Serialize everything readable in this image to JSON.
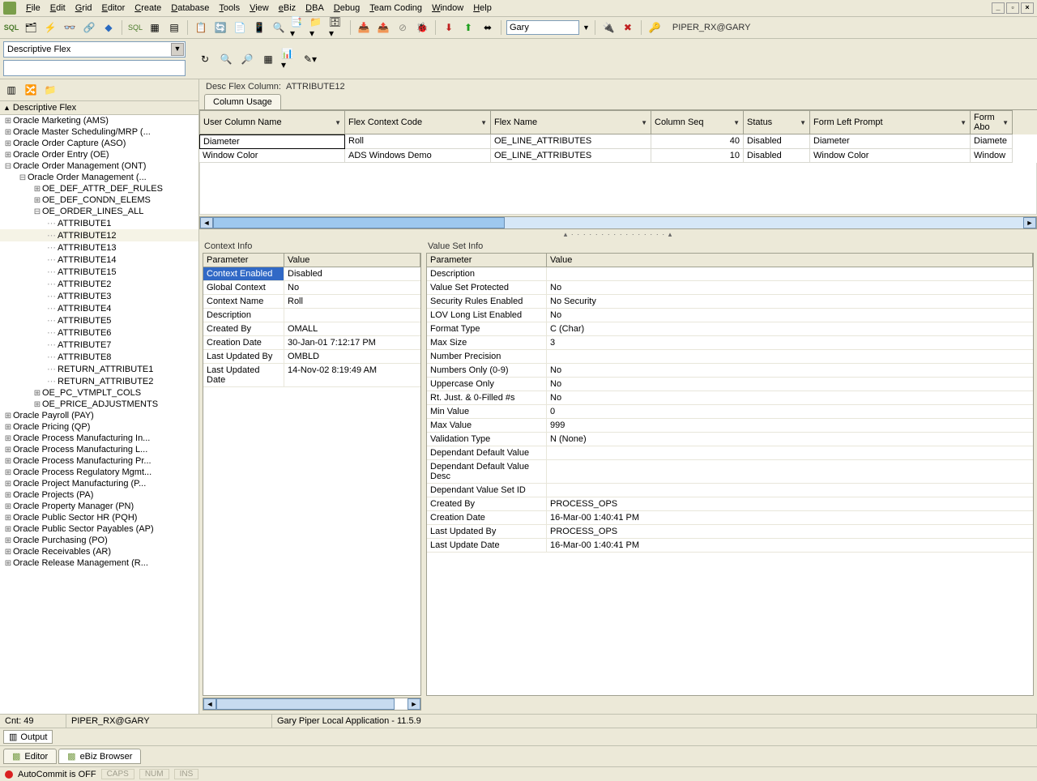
{
  "menubar": [
    "File",
    "Edit",
    "Grid",
    "Editor",
    "Create",
    "Database",
    "Tools",
    "View",
    "eBiz",
    "DBA",
    "Debug",
    "Team Coding",
    "Window",
    "Help"
  ],
  "toolbar": {
    "user": "Gary",
    "db_label": "PIPER_RX@GARY"
  },
  "flex_combo": "Descriptive Flex",
  "tree_header": "Descriptive Flex",
  "tree": [
    {
      "lvl": 0,
      "exp": "+",
      "label": "Oracle Marketing  (AMS)"
    },
    {
      "lvl": 0,
      "exp": "+",
      "label": "Oracle Master Scheduling/MRP  (..."
    },
    {
      "lvl": 0,
      "exp": "+",
      "label": "Oracle Order Capture  (ASO)"
    },
    {
      "lvl": 0,
      "exp": "+",
      "label": "Oracle Order Entry  (OE)"
    },
    {
      "lvl": 0,
      "exp": "-",
      "label": "Oracle Order Management  (ONT)"
    },
    {
      "lvl": 1,
      "exp": "-",
      "label": "Oracle Order Management  (..."
    },
    {
      "lvl": 2,
      "exp": "+",
      "label": "OE_DEF_ATTR_DEF_RULES"
    },
    {
      "lvl": 2,
      "exp": "+",
      "label": "OE_DEF_CONDN_ELEMS"
    },
    {
      "lvl": 2,
      "exp": "-",
      "label": "OE_ORDER_LINES_ALL"
    },
    {
      "lvl": 3,
      "leaf": true,
      "label": "ATTRIBUTE1"
    },
    {
      "lvl": 3,
      "leaf": true,
      "label": "ATTRIBUTE12",
      "selected": true
    },
    {
      "lvl": 3,
      "leaf": true,
      "label": "ATTRIBUTE13"
    },
    {
      "lvl": 3,
      "leaf": true,
      "label": "ATTRIBUTE14"
    },
    {
      "lvl": 3,
      "leaf": true,
      "label": "ATTRIBUTE15"
    },
    {
      "lvl": 3,
      "leaf": true,
      "label": "ATTRIBUTE2"
    },
    {
      "lvl": 3,
      "leaf": true,
      "label": "ATTRIBUTE3"
    },
    {
      "lvl": 3,
      "leaf": true,
      "label": "ATTRIBUTE4"
    },
    {
      "lvl": 3,
      "leaf": true,
      "label": "ATTRIBUTE5"
    },
    {
      "lvl": 3,
      "leaf": true,
      "label": "ATTRIBUTE6"
    },
    {
      "lvl": 3,
      "leaf": true,
      "label": "ATTRIBUTE7"
    },
    {
      "lvl": 3,
      "leaf": true,
      "label": "ATTRIBUTE8"
    },
    {
      "lvl": 3,
      "leaf": true,
      "label": "RETURN_ATTRIBUTE1"
    },
    {
      "lvl": 3,
      "leaf": true,
      "label": "RETURN_ATTRIBUTE2"
    },
    {
      "lvl": 2,
      "exp": "+",
      "label": "OE_PC_VTMPLT_COLS"
    },
    {
      "lvl": 2,
      "exp": "+",
      "label": "OE_PRICE_ADJUSTMENTS"
    },
    {
      "lvl": 0,
      "exp": "+",
      "label": "Oracle Payroll  (PAY)"
    },
    {
      "lvl": 0,
      "exp": "+",
      "label": "Oracle Pricing  (QP)"
    },
    {
      "lvl": 0,
      "exp": "+",
      "label": "Oracle Process Manufacturing In..."
    },
    {
      "lvl": 0,
      "exp": "+",
      "label": "Oracle Process Manufacturing L..."
    },
    {
      "lvl": 0,
      "exp": "+",
      "label": "Oracle Process Manufacturing Pr..."
    },
    {
      "lvl": 0,
      "exp": "+",
      "label": "Oracle Process Regulatory Mgmt..."
    },
    {
      "lvl": 0,
      "exp": "+",
      "label": "Oracle Project Manufacturing  (P..."
    },
    {
      "lvl": 0,
      "exp": "+",
      "label": "Oracle Projects  (PA)"
    },
    {
      "lvl": 0,
      "exp": "+",
      "label": "Oracle Property Manager  (PN)"
    },
    {
      "lvl": 0,
      "exp": "+",
      "label": "Oracle Public Sector HR  (PQH)"
    },
    {
      "lvl": 0,
      "exp": "+",
      "label": "Oracle Public Sector Payables  (AP)"
    },
    {
      "lvl": 0,
      "exp": "+",
      "label": "Oracle Purchasing  (PO)"
    },
    {
      "lvl": 0,
      "exp": "+",
      "label": "Oracle Receivables  (AR)"
    },
    {
      "lvl": 0,
      "exp": "+",
      "label": "Oracle Release Management  (R..."
    }
  ],
  "crumb_label": "Desc Flex Column:",
  "crumb_value": "ATTRIBUTE12",
  "tab": "Column Usage",
  "grid_headers": [
    "User Column Name",
    "Flex Context Code",
    "Flex Name",
    "Column Seq",
    "Status",
    "Form Left Prompt",
    "Form Abo"
  ],
  "grid_rows": [
    {
      "user_col": "Diameter",
      "ctx": "Roll",
      "flex": "OE_LINE_ATTRIBUTES",
      "seq": "40",
      "status": "Disabled",
      "prompt": "Diameter",
      "above": "Diamete",
      "sel": true
    },
    {
      "user_col": "Window Color",
      "ctx": "ADS Windows Demo",
      "flex": "OE_LINE_ATTRIBUTES",
      "seq": "10",
      "status": "Disabled",
      "prompt": "Window Color",
      "above": "Window"
    }
  ],
  "context_title": "Context Info",
  "context_headers": [
    "Parameter",
    "Value"
  ],
  "context_rows": [
    {
      "p": "Context Enabled",
      "v": "Disabled",
      "hl": true
    },
    {
      "p": "Global Context",
      "v": "No"
    },
    {
      "p": "Context Name",
      "v": "Roll"
    },
    {
      "p": "Description",
      "v": ""
    },
    {
      "p": "Created By",
      "v": "OMALL"
    },
    {
      "p": "Creation Date",
      "v": "30-Jan-01 7:12:17 PM"
    },
    {
      "p": "Last Updated By",
      "v": "OMBLD"
    },
    {
      "p": "Last Updated Date",
      "v": "14-Nov-02 8:19:49 AM"
    }
  ],
  "valueset_title": "Value Set Info",
  "valueset_headers": [
    "Parameter",
    "Value"
  ],
  "valueset_rows": [
    {
      "p": "Description",
      "v": ""
    },
    {
      "p": "Value Set Protected",
      "v": "No"
    },
    {
      "p": "Security Rules Enabled",
      "v": "No Security"
    },
    {
      "p": "LOV Long List Enabled",
      "v": "No"
    },
    {
      "p": "Format Type",
      "v": "C (Char)"
    },
    {
      "p": "Max Size",
      "v": "3"
    },
    {
      "p": "Number Precision",
      "v": ""
    },
    {
      "p": "Numbers Only (0-9)",
      "v": "No"
    },
    {
      "p": "Uppercase Only",
      "v": "No"
    },
    {
      "p": "Rt. Just. & 0-Filled #s",
      "v": "No"
    },
    {
      "p": "Min Value",
      "v": "0"
    },
    {
      "p": "Max Value",
      "v": "999"
    },
    {
      "p": "Validation Type",
      "v": "N (None)"
    },
    {
      "p": "Dependant Default Value",
      "v": ""
    },
    {
      "p": "Dependant Default Value Desc",
      "v": ""
    },
    {
      "p": "Dependant Value Set ID",
      "v": ""
    },
    {
      "p": "Created By",
      "v": "PROCESS_OPS"
    },
    {
      "p": "Creation Date",
      "v": "16-Mar-00 1:40:41 PM"
    },
    {
      "p": "Last Updated By",
      "v": "PROCESS_OPS"
    },
    {
      "p": "Last Update Date",
      "v": "16-Mar-00 1:40:41 PM"
    }
  ],
  "status": {
    "cnt": "Cnt: 49",
    "conn": "PIPER_RX@GARY",
    "app": "Gary Piper Local Application - 11.5.9"
  },
  "output_tab": "Output",
  "editor_tabs": [
    "Editor",
    "eBiz Browser"
  ],
  "footer": {
    "autocommit": "AutoCommit is OFF",
    "caps": "CAPS",
    "num": "NUM",
    "ins": "INS"
  }
}
